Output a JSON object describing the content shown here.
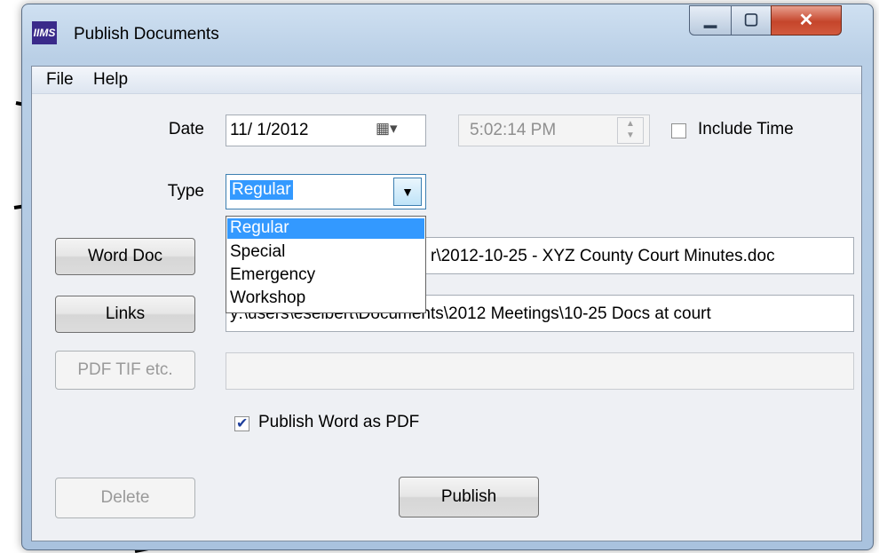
{
  "window": {
    "title": "Publish Documents",
    "app_icon": "IIMS"
  },
  "menu": {
    "items": [
      "File",
      "Help"
    ]
  },
  "form": {
    "date_label": "Date",
    "date_value": "11/ 1/2012",
    "time_value": "5:02:14 PM",
    "include_time_label": "Include Time",
    "include_time_checked": false,
    "type_label": "Type",
    "type_value": "Regular",
    "type_options": [
      "Regular",
      "Special",
      "Emergency",
      "Workshop"
    ],
    "word_doc_button": "Word Doc",
    "word_doc_path": "r\\2012-10-25 - XYZ County Court Minutes.doc",
    "links_button": "Links",
    "links_path": "y:\\users\\eseibert\\Documents\\2012 Meetings\\10-25 Docs at court",
    "pdf_button": "PDF TIF etc.",
    "pdf_path": "",
    "publish_pdf_label": "Publish Word as PDF",
    "publish_pdf_checked": true,
    "delete_button": "Delete",
    "publish_button": "Publish"
  },
  "colors": {
    "selection": "#3399ff",
    "close_button": "#c5452b"
  }
}
